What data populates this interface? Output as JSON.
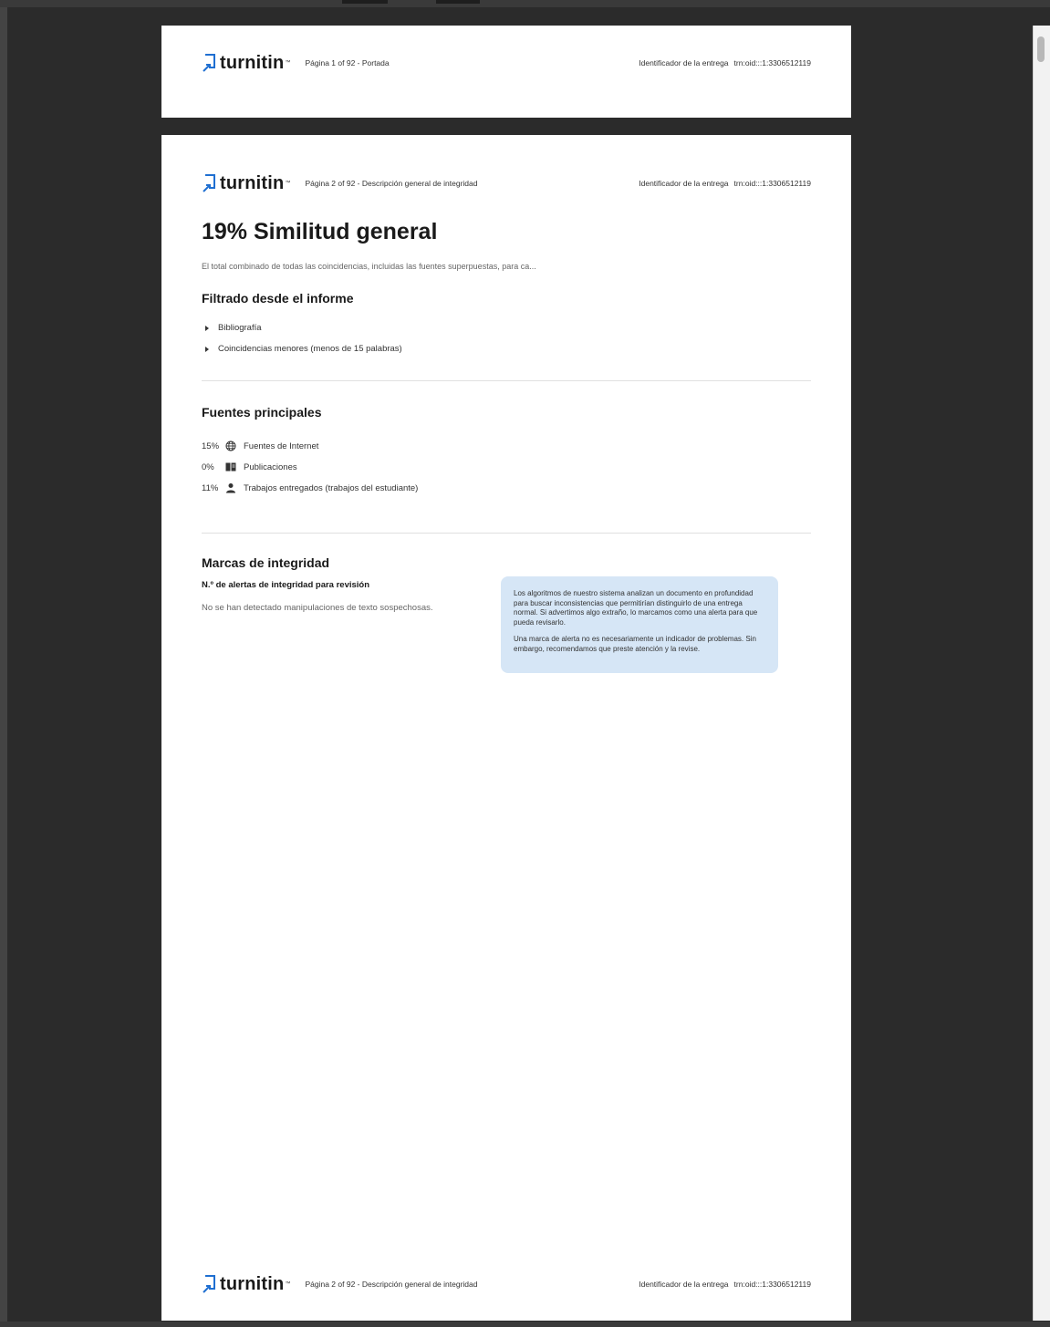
{
  "brand": {
    "name": "turnitin",
    "tm": "™"
  },
  "pages": [
    {
      "page_info": "Página 1 of 92 - Portada",
      "submission_label": "Identificador de la entrega",
      "submission_id": "trn:oid:::1:3306512119"
    },
    {
      "page_info": "Página 2 of 92 - Descripción general de integridad",
      "submission_label": "Identificador de la entrega",
      "submission_id": "trn:oid:::1:3306512119",
      "title": "19% Similitud general",
      "description": "El total combinado de todas las coincidencias, incluidas las fuentes superpuestas, para ca...",
      "filtered": {
        "heading": "Filtrado desde el informe",
        "items": [
          "Bibliografía",
          "Coincidencias menores (menos de 15 palabras)"
        ]
      },
      "sources": {
        "heading": "Fuentes principales",
        "items": [
          {
            "percent": "15%",
            "icon": "globe-icon",
            "label": "Fuentes de Internet"
          },
          {
            "percent": "0%",
            "icon": "book-icon",
            "label": "Publicaciones"
          },
          {
            "percent": "11%",
            "icon": "person-icon",
            "label": "Trabajos entregados (trabajos del estudiante)"
          }
        ]
      },
      "integrity": {
        "heading": "Marcas de integridad",
        "subheading": "N.º de alertas de integridad para revisión",
        "no_alerts": "No se han detectado manipulaciones de texto sospechosas.",
        "info_paragraph_1": "Los algoritmos de nuestro sistema analizan un documento en profundidad para buscar inconsistencias que permitirían distinguirlo de una entrega normal. Si advertimos algo extraño, lo marcamos como una alerta para que pueda revisarlo.",
        "info_paragraph_2": "Una marca de alerta no es necesariamente un indicador de problemas. Sin embargo, recomendamos que preste atención y la revise."
      },
      "footer_page_info": "Página 2 of 92 - Descripción general de integridad"
    }
  ],
  "colors": {
    "brand_blue": "#1f6fd1",
    "info_box": "#d6e6f6",
    "background": "#2b2b2b"
  }
}
